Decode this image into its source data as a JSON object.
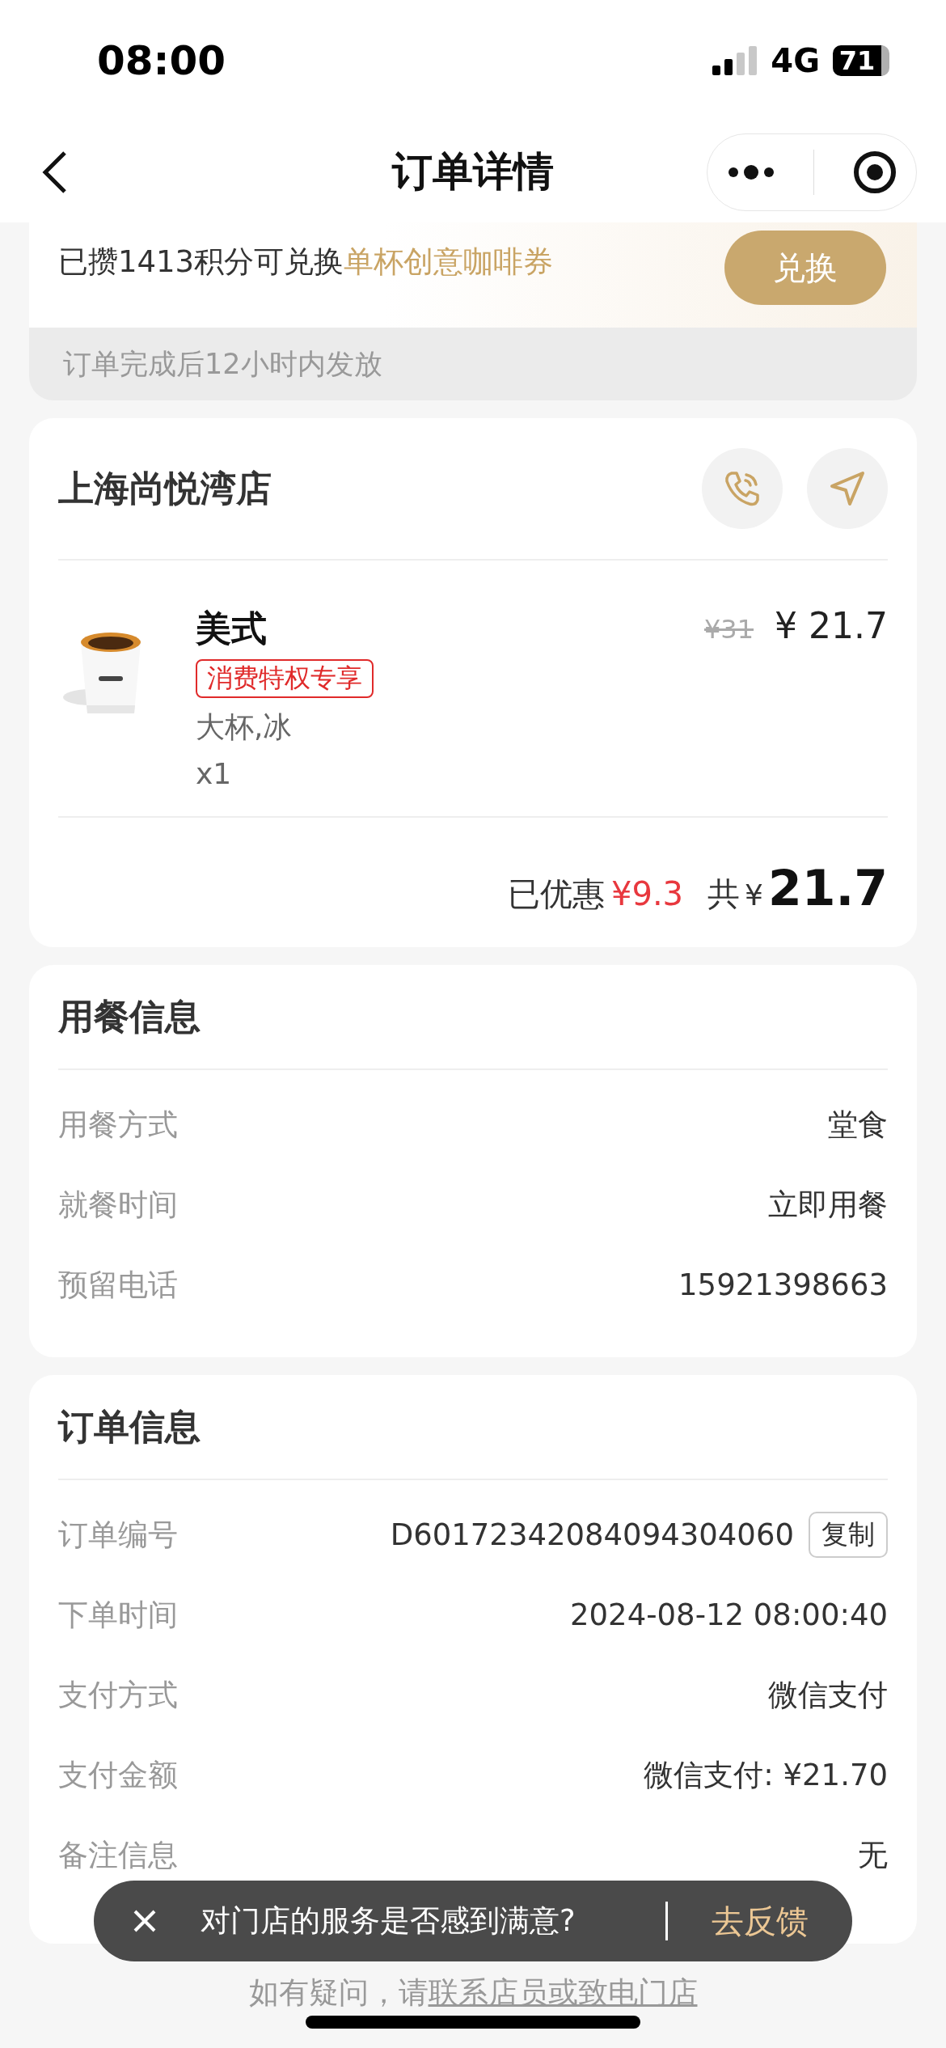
{
  "status_bar": {
    "time": "08:00",
    "network": "4G",
    "battery": "71"
  },
  "nav": {
    "title": "订单详情"
  },
  "points": {
    "text": "已攒1413积分可兑换",
    "highlight": "单杯创意咖啡券",
    "button": "兑换",
    "note": "订单完成后12小时内发放"
  },
  "store": {
    "name": "上海尚悦湾店",
    "items": [
      {
        "name": "美式",
        "tag": "消费特权专享",
        "options": "大杯,冰",
        "quantity": "x1",
        "original_price": "¥31",
        "price": "¥ 21.7"
      }
    ],
    "summary": {
      "discount_label": "已优惠",
      "discount": "¥9.3",
      "total_label": "共",
      "currency": "¥",
      "total": "21.7"
    }
  },
  "dining": {
    "title": "用餐信息",
    "rows": [
      {
        "label": "用餐方式",
        "value": "堂食"
      },
      {
        "label": "就餐时间",
        "value": "立即用餐"
      },
      {
        "label": "预留电话",
        "value": "15921398663"
      }
    ]
  },
  "order": {
    "title": "订单信息",
    "rows": [
      {
        "label": "订单编号",
        "value": "D60172342084094304060",
        "action": "复制"
      },
      {
        "label": "下单时间",
        "value": "2024-08-12 08:00:40"
      },
      {
        "label": "支付方式",
        "value": "微信支付"
      },
      {
        "label": "支付金额",
        "value": "微信支付: ¥21.70"
      },
      {
        "label": "备注信息",
        "value": "无"
      }
    ]
  },
  "toast": {
    "message": "对门店的服务是否感到满意?",
    "action": "去反馈"
  },
  "footer": {
    "text": "如有疑问，请",
    "link": "联系店员或致电门店"
  }
}
